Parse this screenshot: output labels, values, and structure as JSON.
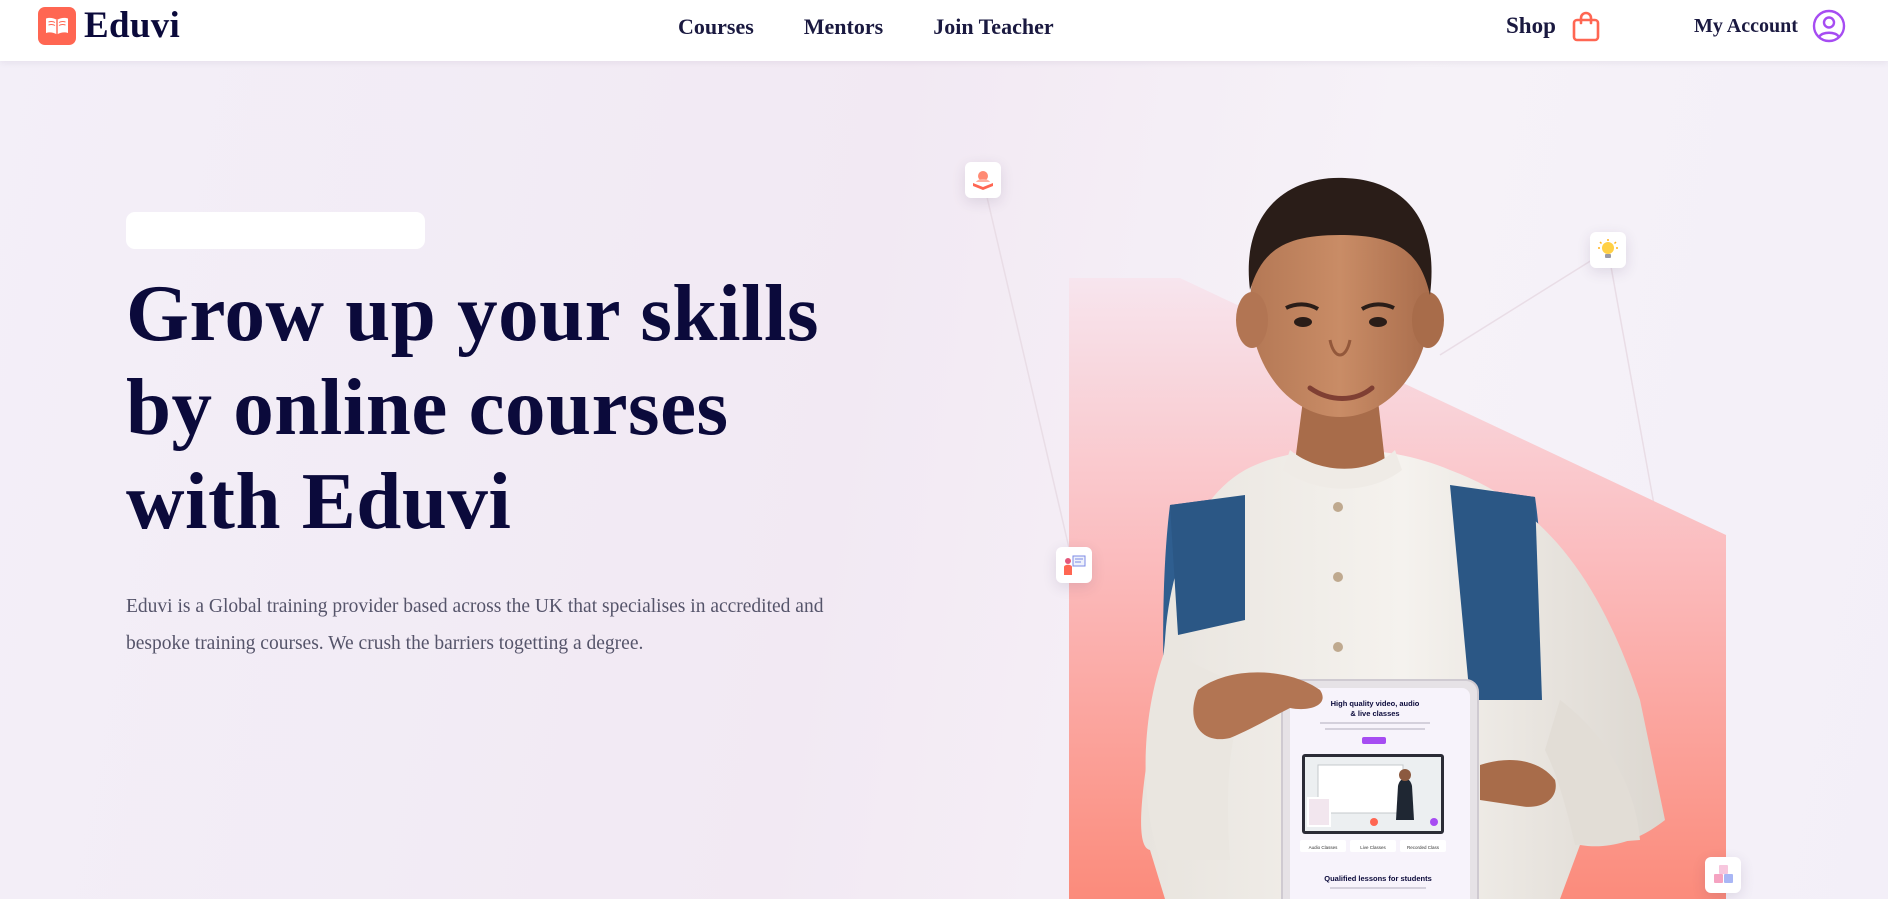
{
  "brand": {
    "name": "Eduvi",
    "accent": "#ff6652",
    "text_dark": "#0b0a3b",
    "account_accent": "#a64cf2"
  },
  "nav": {
    "items": [
      {
        "label": "Courses"
      },
      {
        "label": "Mentors"
      },
      {
        "label": "Join Teacher"
      }
    ]
  },
  "header": {
    "shop_label": "Shop",
    "account_label": "My Account"
  },
  "icons": {
    "logo": "open-book-icon",
    "shop": "shopping-bag-icon",
    "account": "user-circle-icon",
    "floating": [
      "reading-book-icon",
      "lightbulb-icon",
      "teacher-board-icon",
      "alphabet-blocks-icon"
    ]
  },
  "hero": {
    "title_lines": [
      "Grow up your skills",
      "by online courses",
      "with Eduvi"
    ],
    "description_lines": [
      "Eduvi is a Global training provider based across the UK that specialises in accredited and",
      "bespoke training courses. We crush the barriers togetting a degree."
    ]
  },
  "tablet": {
    "heading_line1": "High quality video, audio",
    "heading_line2": "& live classes",
    "features": [
      "Audio Classes",
      "Live Classes",
      "Recorded Class"
    ],
    "bottom_heading": "Qualified lessons for students"
  }
}
